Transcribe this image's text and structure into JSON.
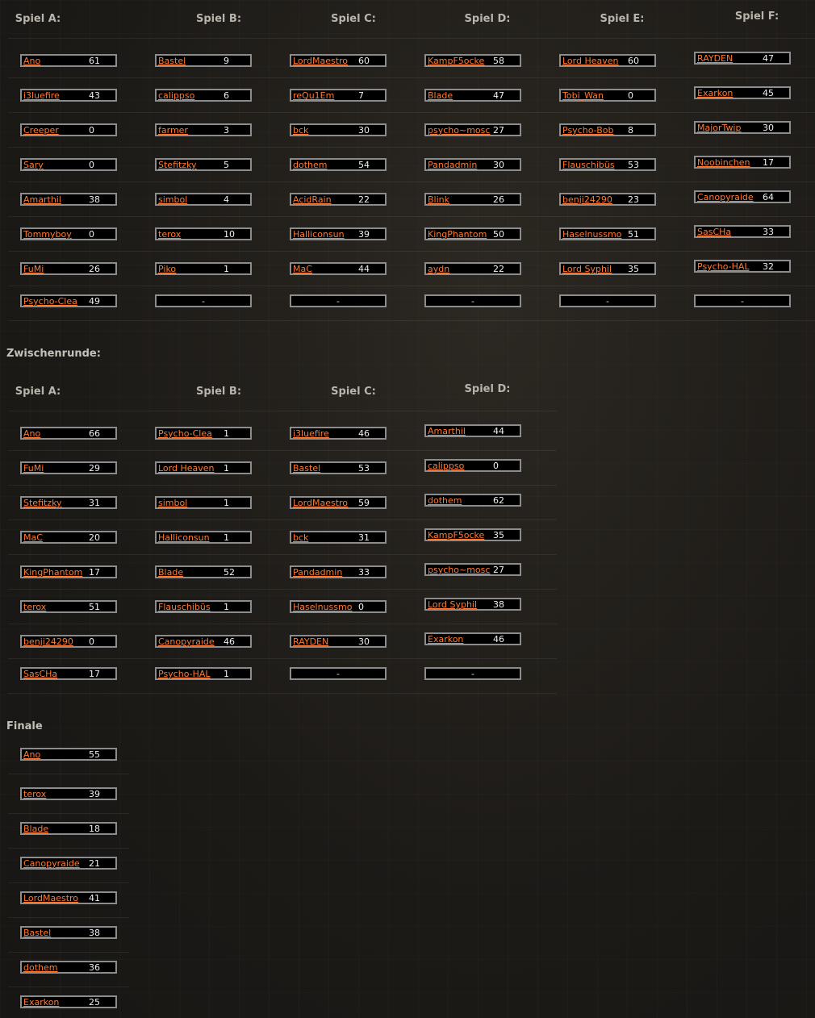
{
  "groups": {
    "headings": [
      "Spiel A:",
      "Spiel B:",
      "Spiel C:",
      "Spiel D:",
      "Spiel E:",
      "Spiel F:"
    ],
    "columns": [
      [
        [
          "Ano",
          "61"
        ],
        [
          "i3luefire",
          "43"
        ],
        [
          "Creeper",
          "0"
        ],
        [
          "Sary",
          "0"
        ],
        [
          "Amarthil",
          "38"
        ],
        [
          "Tommyboy",
          "0"
        ],
        [
          "FuMi",
          "26"
        ],
        [
          "Psycho-Clea",
          "49"
        ]
      ],
      [
        [
          "Bastel",
          "9"
        ],
        [
          "calippso",
          "6"
        ],
        [
          "farmer",
          "3"
        ],
        [
          "Stefitzky",
          "5"
        ],
        [
          "simbol",
          "4"
        ],
        [
          "terox",
          "10"
        ],
        [
          "Piko",
          "1"
        ],
        [
          "-",
          ""
        ]
      ],
      [
        [
          "LordMaestro",
          "60"
        ],
        [
          "reQu1Em",
          "7"
        ],
        [
          "bck",
          "30"
        ],
        [
          "dothem",
          "54"
        ],
        [
          "AcidRain",
          "22"
        ],
        [
          "Halliconsun",
          "39"
        ],
        [
          "MaC",
          "44"
        ],
        [
          "-",
          ""
        ]
      ],
      [
        [
          "KampF5ocke",
          "58"
        ],
        [
          "Blade",
          "47"
        ],
        [
          "psycho~mosc",
          "27"
        ],
        [
          "Pandadmin",
          "30"
        ],
        [
          "Blink",
          "26"
        ],
        [
          "KingPhantom",
          "50"
        ],
        [
          "aydn",
          "22"
        ],
        [
          "-",
          ""
        ]
      ],
      [
        [
          "Lord Heaven",
          "60"
        ],
        [
          "Tobi_Wan",
          "0"
        ],
        [
          "Psycho-Bob",
          "8"
        ],
        [
          "Flauschibüs",
          "53"
        ],
        [
          "benji24290",
          "23"
        ],
        [
          "Haselnussmo",
          "51"
        ],
        [
          "Lord Syphil",
          "35"
        ],
        [
          "-",
          ""
        ]
      ],
      [
        [
          "RAYDEN",
          "47"
        ],
        [
          "Exarkon",
          "45"
        ],
        [
          "MajorTwip",
          "30"
        ],
        [
          "Noobinchen",
          "17"
        ],
        [
          "Canopyraide",
          "64"
        ],
        [
          "SasCHa",
          "33"
        ],
        [
          "Psycho-HAL",
          "32"
        ],
        [
          "-",
          ""
        ]
      ]
    ]
  },
  "zwischenrunde": {
    "title": "Zwischenrunde:",
    "headings": [
      "Spiel A:",
      "Spiel B:",
      "Spiel C:",
      "Spiel D:"
    ],
    "columns": [
      [
        [
          "Ano",
          "66"
        ],
        [
          "FuMi",
          "29"
        ],
        [
          "Stefitzky",
          "31"
        ],
        [
          "MaC",
          "20"
        ],
        [
          "KingPhantom",
          "17"
        ],
        [
          "terox",
          "51"
        ],
        [
          "benji24290",
          "0"
        ],
        [
          "SasCHa",
          "17"
        ]
      ],
      [
        [
          "Psycho-Clea",
          "1"
        ],
        [
          "Lord Heaven",
          "1"
        ],
        [
          "simbol",
          "1"
        ],
        [
          "Halliconsun",
          "1"
        ],
        [
          "Blade",
          "52"
        ],
        [
          "Flauschibüs",
          "1"
        ],
        [
          "Canopyraide",
          "46"
        ],
        [
          "Psycho-HAL",
          "1"
        ]
      ],
      [
        [
          "i3luefire",
          "46"
        ],
        [
          "Bastel",
          "53"
        ],
        [
          "LordMaestro",
          "59"
        ],
        [
          "bck",
          "31"
        ],
        [
          "Pandadmin",
          "33"
        ],
        [
          "Haselnussmo",
          "0"
        ],
        [
          "RAYDEN",
          "30"
        ],
        [
          "-",
          ""
        ]
      ],
      [
        [
          "Amarthil",
          "44"
        ],
        [
          "calippso",
          "0"
        ],
        [
          "dothem",
          "62"
        ],
        [
          "KampF5ocke",
          "35"
        ],
        [
          "psycho~mosc",
          "27"
        ],
        [
          "Lord Syphil",
          "38"
        ],
        [
          "Exarkon",
          "46"
        ],
        [
          "-",
          ""
        ]
      ]
    ]
  },
  "finale": {
    "title": "Finale",
    "entries": [
      [
        "Ano",
        "55"
      ],
      [
        "terox",
        "39"
      ],
      [
        "Blade",
        "18"
      ],
      [
        "Canopyraide",
        "21"
      ],
      [
        "LordMaestro",
        "41"
      ],
      [
        "Bastel",
        "38"
      ],
      [
        "dothem",
        "36"
      ],
      [
        "Exarkon",
        "25"
      ]
    ]
  }
}
